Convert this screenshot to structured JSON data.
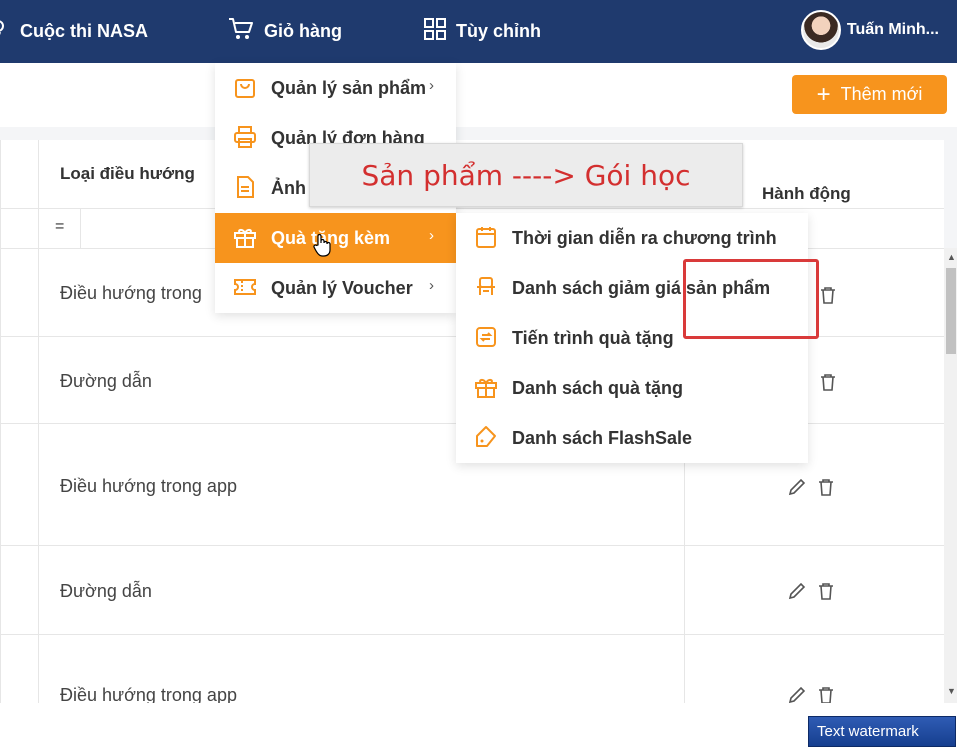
{
  "topbar": {
    "items": [
      {
        "label": "Cuộc thi NASA",
        "icon": "contest-icon"
      },
      {
        "label": "Giỏ hàng",
        "icon": "cart-icon"
      },
      {
        "label": "Tùy chỉnh",
        "icon": "grid-icon"
      }
    ],
    "user_name": "Tuấn Minh..."
  },
  "toolbar": {
    "add_label": "Thêm mới"
  },
  "table": {
    "headers": {
      "nav_type": "Loại điều hướng",
      "actions": "Hành động"
    },
    "filter_value": "=",
    "rows": [
      {
        "nav_type": "Điều hướng trong"
      },
      {
        "nav_type": "Đường dẫn"
      },
      {
        "nav_type": "Điều hướng trong app"
      },
      {
        "nav_type": "Đường dẫn"
      },
      {
        "nav_type": "Điều hướng trong app"
      }
    ]
  },
  "cart_menu": {
    "items": [
      {
        "label": "Quản lý sản phẩm",
        "icon": "bag-icon",
        "has_submenu": true
      },
      {
        "label": "Quản lý đơn hàng",
        "icon": "printer-icon",
        "has_submenu": false
      },
      {
        "label": "Ảnh",
        "icon": "document-icon",
        "has_submenu": false
      },
      {
        "label": "Quà tặng kèm",
        "icon": "gift-icon",
        "has_submenu": true,
        "active": true
      },
      {
        "label": "Quản lý Voucher",
        "icon": "ticket-icon",
        "has_submenu": true
      }
    ]
  },
  "gift_submenu": {
    "items": [
      {
        "label": "Thời gian diễn ra chương trình",
        "icon": "calendar-icon"
      },
      {
        "label": "Danh sách giảm giá sản phẩm",
        "icon": "chair-icon"
      },
      {
        "label": "Tiến trình quà tặng",
        "icon": "cycle-icon"
      },
      {
        "label": "Danh sách quà tặng",
        "icon": "gift-icon"
      },
      {
        "label": "Danh sách FlashSale",
        "icon": "tag-icon"
      }
    ]
  },
  "annotation": {
    "text": "Sản phẩm ----> Gói học"
  },
  "watermark": {
    "text": "Text watermark"
  },
  "colors": {
    "topbar": "#1f3a6e",
    "accent": "#f7941d",
    "annotation_red": "#d32f2f"
  }
}
